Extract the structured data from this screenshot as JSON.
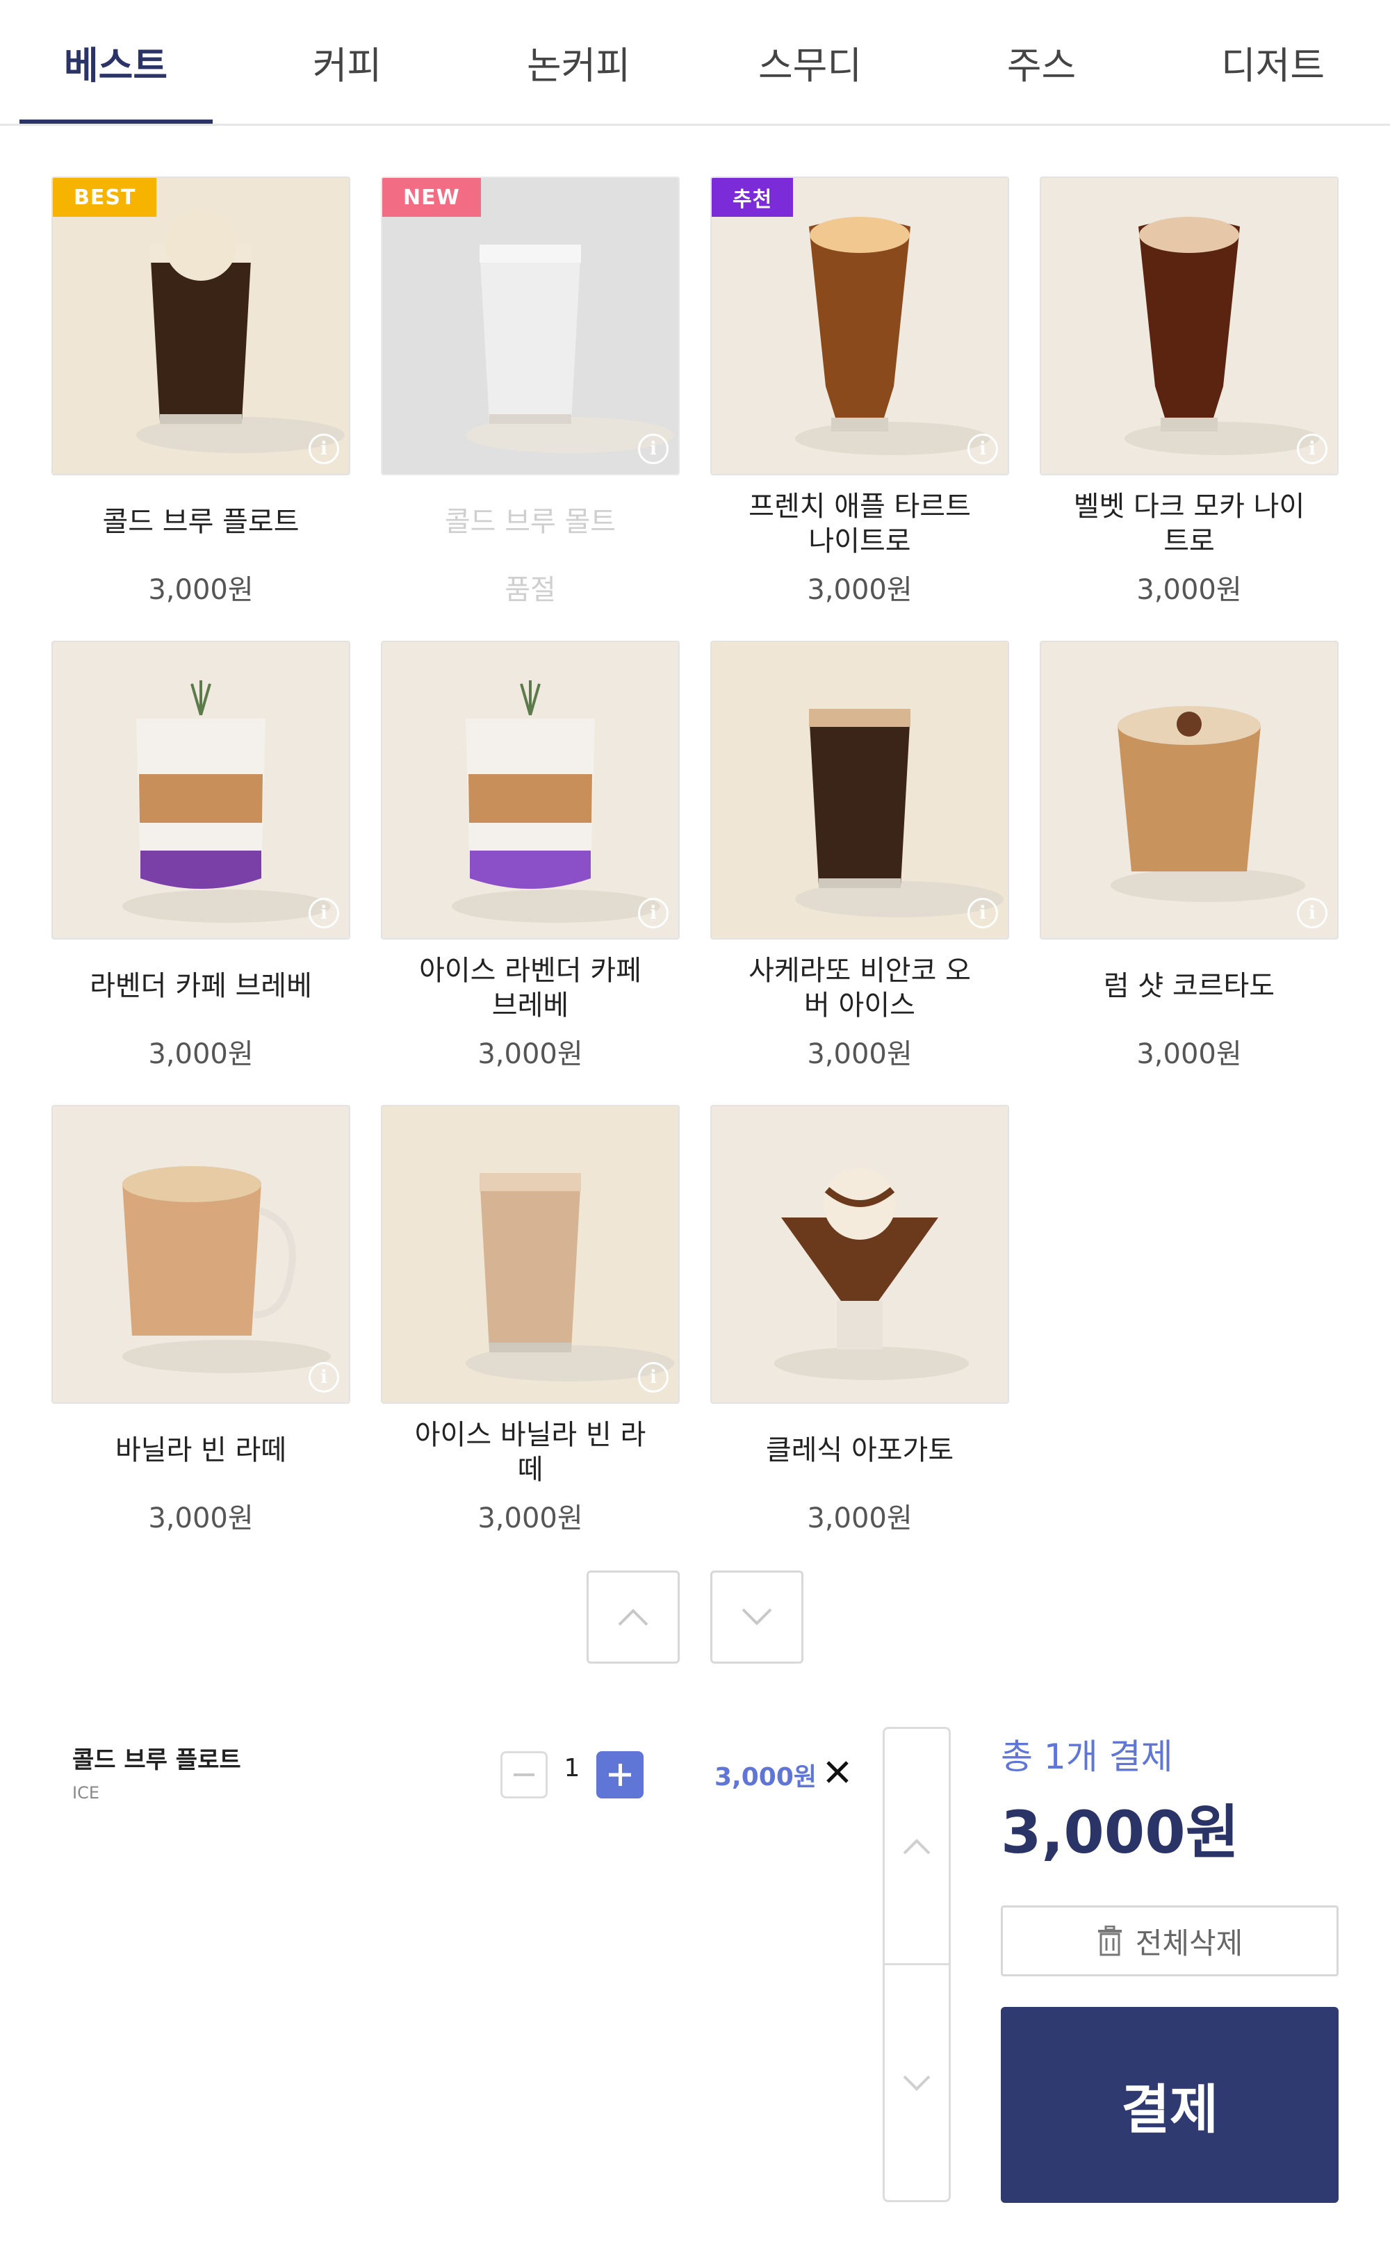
{
  "tabs": [
    "베스트",
    "커피",
    "논커피",
    "스무디",
    "주스",
    "디저트"
  ],
  "products": [
    {
      "name": "콜드 브루 플로트",
      "price": "3,000원",
      "badge": "BEST",
      "badge_color": "#f6b400",
      "sold_out": false,
      "image": "cold-brew-float"
    },
    {
      "name": "콜드 브루 몰트",
      "price": "품절",
      "badge": "NEW",
      "badge_color": "#ee3d5a",
      "sold_out": true,
      "image": "cold-brew-malt"
    },
    {
      "name": "프렌치 애플 타르트 나이트로",
      "price": "3,000원",
      "badge": "추천",
      "badge_color": "#7b2bd8",
      "sold_out": false,
      "image": "french-apple-tart-nitro"
    },
    {
      "name": "벨벳 다크 모카 나이트로",
      "price": "3,000원",
      "badge": "",
      "badge_color": "",
      "sold_out": false,
      "image": "velvet-dark-mocha-nitro"
    },
    {
      "name": "라벤더 카페 브레베",
      "price": "3,000원",
      "badge": "",
      "badge_color": "",
      "sold_out": false,
      "image": "lavender-cafe-breve"
    },
    {
      "name": "아이스 라벤더 카페 브레베",
      "price": "3,000원",
      "badge": "",
      "badge_color": "",
      "sold_out": false,
      "image": "iced-lavender-cafe-breve"
    },
    {
      "name": "사케라또 비안코 오버 아이스",
      "price": "3,000원",
      "badge": "",
      "badge_color": "",
      "sold_out": false,
      "image": "shakerato-bianco"
    },
    {
      "name": "럼 샷 코르타도",
      "price": "3,000원",
      "badge": "",
      "badge_color": "",
      "sold_out": false,
      "image": "rum-shot-cortado"
    },
    {
      "name": "바닐라 빈 라떼",
      "price": "3,000원",
      "badge": "",
      "badge_color": "",
      "sold_out": false,
      "image": "vanilla-bean-latte"
    },
    {
      "name": "아이스 바닐라 빈 라떼",
      "price": "3,000원",
      "badge": "",
      "badge_color": "",
      "sold_out": false,
      "image": "iced-vanilla-bean-latte"
    },
    {
      "name": "클레식 아포가토",
      "price": "3,000원",
      "badge": "",
      "badge_color": "",
      "sold_out": false,
      "image": "classic-affogato"
    }
  ],
  "cart": {
    "items": [
      {
        "name": "콜드 브루 플로트",
        "option": "ICE",
        "qty": "1",
        "price": "3,000원"
      }
    ],
    "total_label": "총 1개 결제",
    "total_amount": "3,000원",
    "clear_label": "전체삭제",
    "pay_label": "결제"
  },
  "colors": {
    "accent": "#5f76d6",
    "primary": "#2e3a70"
  }
}
